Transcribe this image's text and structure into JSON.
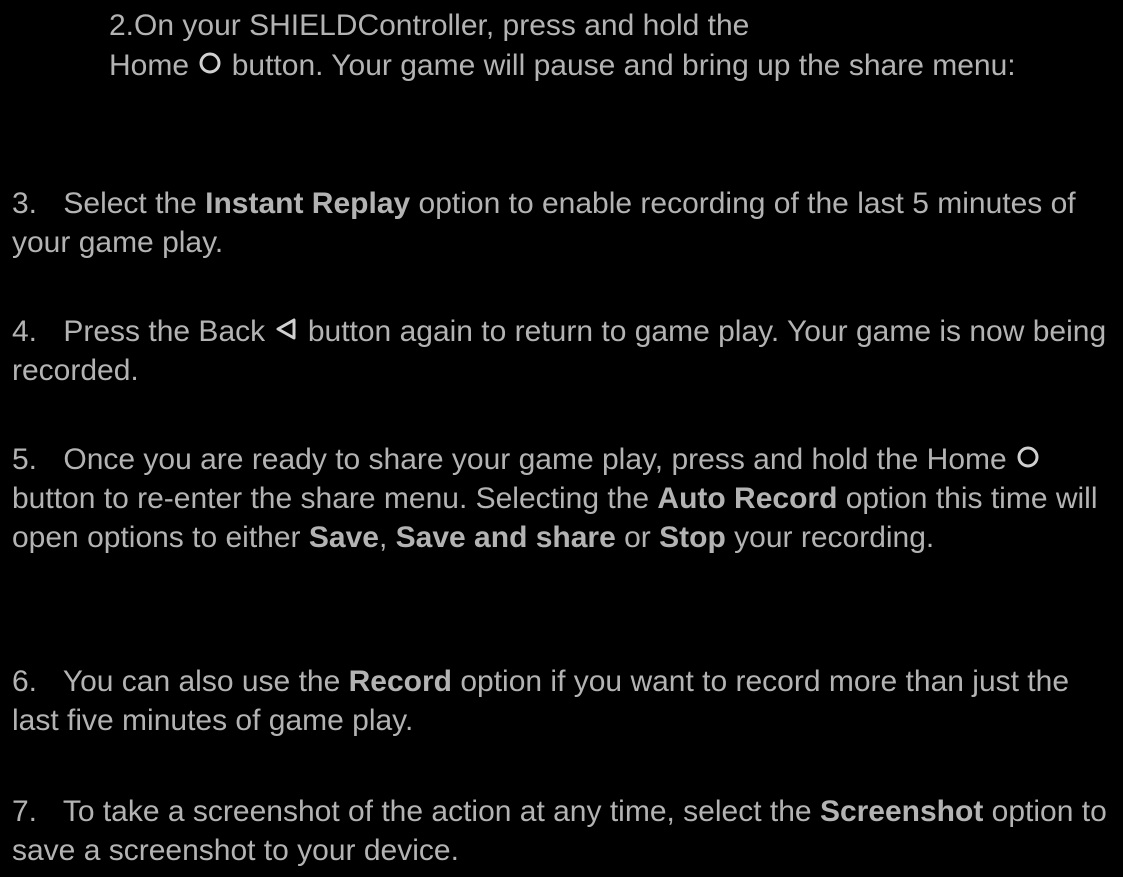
{
  "steps": [
    {
      "num": "2.",
      "parts": [
        "On your SHIELD",
        "Controller, press and hold the",
        "Home",
        "button.   Your game will pause and bring up the share menu:"
      ],
      "icon": "home-circle-icon"
    },
    {
      "num": "3.",
      "parts": [
        "Select the",
        "Instant Replay",
        "option to enable recording of the last 5 minutes of your game play."
      ]
    },
    {
      "num": "4.",
      "parts": [
        "Press the Back",
        "button again to return to game play.   Your game is now being recorded."
      ],
      "icon": "back-triangle-icon"
    },
    {
      "num": "5.",
      "parts": [
        "Once you are ready to share your game play, press and hold the Home",
        "button to re-enter the share menu.   Selecting the",
        "Auto Record",
        "option this time will open options to either",
        "Save",
        ",",
        "Save and share",
        "or",
        "Stop",
        "your recording."
      ],
      "icon": "home-circle-icon"
    },
    {
      "num": "6.",
      "parts": [
        "You can also use the",
        "Record",
        "option if you want to record more than just the last five minutes of game play."
      ]
    },
    {
      "num": "7.",
      "parts": [
        "To take a screenshot of the action at any time, select the",
        "Screenshot",
        "option to save a screenshot to your device."
      ]
    }
  ],
  "colors": {
    "background": "#000000",
    "text": "#b3b3b3"
  }
}
